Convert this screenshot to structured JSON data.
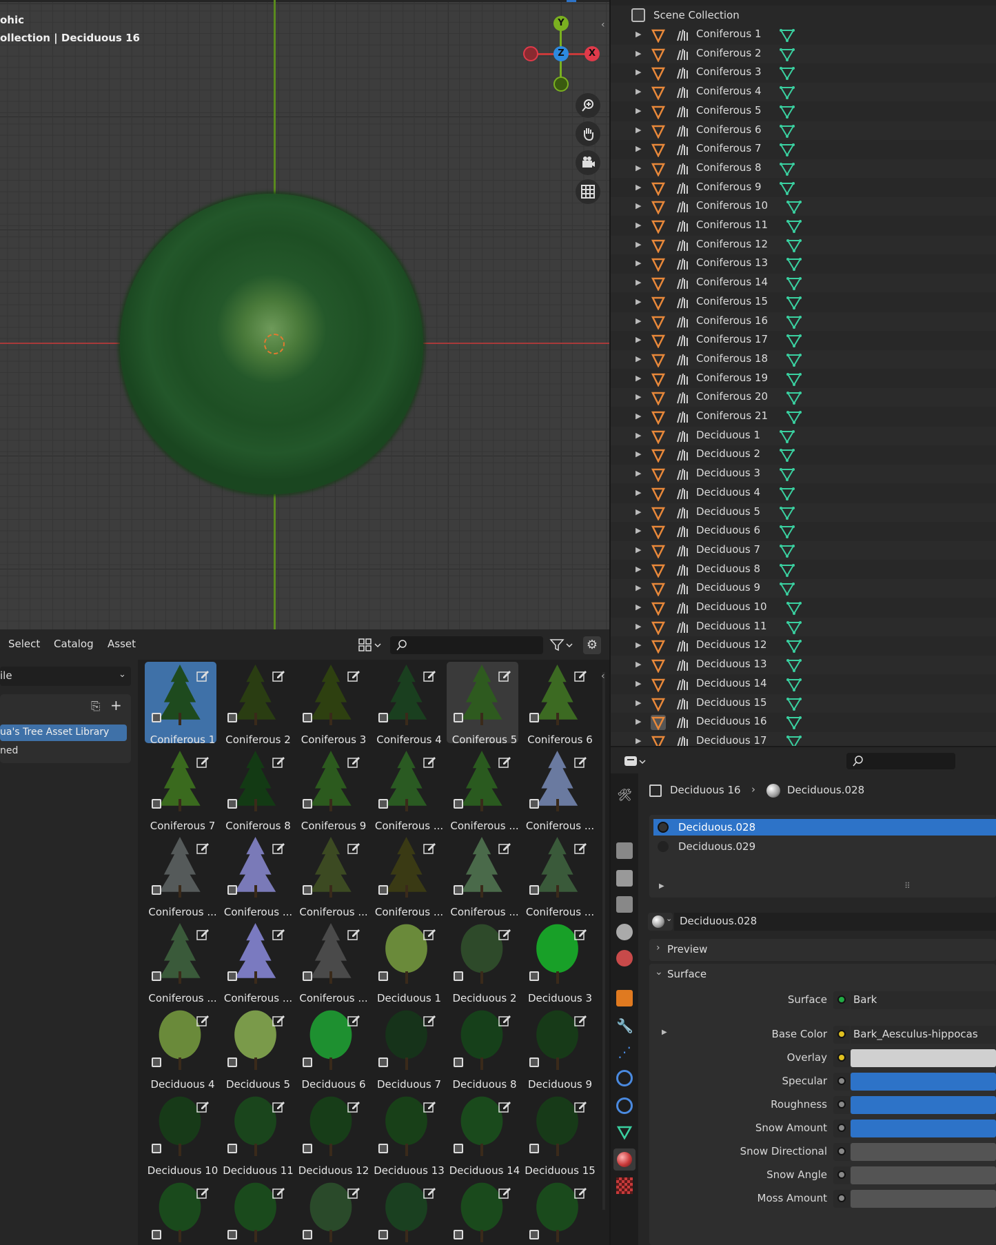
{
  "viewport": {
    "line1": "ohic",
    "line2": "ollection | Deciduous 16",
    "gizmo": {
      "y": "Y",
      "x": "X",
      "z": "Z"
    },
    "nav_icons": [
      "zoom-icon",
      "hand-icon",
      "camera-icon",
      "grid-icon"
    ]
  },
  "asset_browser": {
    "menus": [
      "Select",
      "Catalog",
      "Asset"
    ],
    "search_placeholder": "",
    "dropdown_value": "ile",
    "library_item": "ua's Tree Asset Library",
    "unassigned": "ned",
    "assets": [
      {
        "label": "Coniferous 1",
        "color": "#1e4a1e"
      },
      {
        "label": "Coniferous 2",
        "color": "#2a3d12"
      },
      {
        "label": "Coniferous 3",
        "color": "#2e4010"
      },
      {
        "label": "Coniferous 4",
        "color": "#1a3f1f"
      },
      {
        "label": "Coniferous 5",
        "color": "#2e5a1f"
      },
      {
        "label": "Coniferous 6",
        "color": "#3c6a22"
      },
      {
        "label": "Coniferous 7",
        "color": "#3a6a1e"
      },
      {
        "label": "Coniferous 8",
        "color": "#133a14"
      },
      {
        "label": "Coniferous 9",
        "color": "#2c5a1e"
      },
      {
        "label": "Coniferous ...",
        "color": "#2a5a22"
      },
      {
        "label": "Coniferous ...",
        "color": "#2a5a1f"
      },
      {
        "label": "Coniferous ...",
        "color": "#6a7aa0"
      },
      {
        "label": "Coniferous ...",
        "color": "#555a5a"
      },
      {
        "label": "Coniferous ...",
        "color": "#7a7ab8"
      },
      {
        "label": "Coniferous ...",
        "color": "#3c4a22"
      },
      {
        "label": "Coniferous ...",
        "color": "#3a3a14"
      },
      {
        "label": "Coniferous ...",
        "color": "#4a6a4a"
      },
      {
        "label": "Coniferous ...",
        "color": "#3a5a3a"
      },
      {
        "label": "Coniferous ...",
        "color": "#3a5a3a"
      },
      {
        "label": "Coniferous ...",
        "color": "#7a7ac0"
      },
      {
        "label": "Coniferous ...",
        "color": "#4a4a4a"
      },
      {
        "label": "Deciduous 1",
        "color": "#6a8a3a"
      },
      {
        "label": "Deciduous 2",
        "color": "#2e4a2a"
      },
      {
        "label": "Deciduous 3",
        "color": "#18a028"
      },
      {
        "label": "Deciduous 4",
        "color": "#6a8a3a"
      },
      {
        "label": "Deciduous 5",
        "color": "#7a9a4a"
      },
      {
        "label": "Deciduous 6",
        "color": "#1e9030"
      },
      {
        "label": "Deciduous 7",
        "color": "#16331a"
      },
      {
        "label": "Deciduous 8",
        "color": "#16401a"
      },
      {
        "label": "Deciduous 9",
        "color": "#173a18"
      },
      {
        "label": "Deciduous 10",
        "color": "#173a18"
      },
      {
        "label": "Deciduous 11",
        "color": "#1a451c"
      },
      {
        "label": "Deciduous 12",
        "color": "#173d18"
      },
      {
        "label": "Deciduous 13",
        "color": "#184018"
      },
      {
        "label": "Deciduous 14",
        "color": "#1a4a1c"
      },
      {
        "label": "Deciduous 15",
        "color": "#173a18"
      },
      {
        "label": "",
        "color": "#1a4a1c"
      },
      {
        "label": "",
        "color": "#1a4a1c"
      },
      {
        "label": "",
        "color": "#2a4a2a"
      },
      {
        "label": "",
        "color": "#1a4020"
      },
      {
        "label": "",
        "color": "#1a4a1c"
      },
      {
        "label": "",
        "color": "#1a4a1c"
      }
    ]
  },
  "outliner": {
    "root": "Scene Collection",
    "items": [
      "Coniferous 1",
      "Coniferous 2",
      "Coniferous 3",
      "Coniferous 4",
      "Coniferous 5",
      "Coniferous 6",
      "Coniferous 7",
      "Coniferous 8",
      "Coniferous 9",
      "Coniferous 10",
      "Coniferous 11",
      "Coniferous 12",
      "Coniferous 13",
      "Coniferous 14",
      "Coniferous 15",
      "Coniferous 16",
      "Coniferous 17",
      "Coniferous 18",
      "Coniferous 19",
      "Coniferous 20",
      "Coniferous 21",
      "Deciduous 1",
      "Deciduous 2",
      "Deciduous 3",
      "Deciduous 4",
      "Deciduous 5",
      "Deciduous 6",
      "Deciduous 7",
      "Deciduous 8",
      "Deciduous 9",
      "Deciduous 10",
      "Deciduous 11",
      "Deciduous 12",
      "Deciduous 13",
      "Deciduous 14",
      "Deciduous 15",
      "Deciduous 16",
      "Deciduous 17"
    ]
  },
  "properties": {
    "breadcrumb_object": "Deciduous 16",
    "breadcrumb_material": "Deciduous.028",
    "slots": [
      "Deciduous.028",
      "Deciduous.029"
    ],
    "material_name": "Deciduous.028",
    "panel_preview": "Preview",
    "panel_surface": "Surface",
    "rows": [
      {
        "label": "Surface",
        "value": "Bark",
        "dot": "#22aa44"
      },
      {
        "label": "Base Color",
        "value": "Bark_Aesculus-hippocas",
        "dot": "#e0c020"
      },
      {
        "label": "Overlay",
        "value": "",
        "dot": "#e0c020",
        "bar": "#d0d0d0"
      },
      {
        "label": "Specular",
        "value": "",
        "dot": "#888888",
        "bar": "#2d73c8"
      },
      {
        "label": "Roughness",
        "value": "",
        "dot": "#888888",
        "bar": "#2d73c8"
      },
      {
        "label": "Snow Amount",
        "value": "",
        "dot": "#888888",
        "bar": "#2d73c8"
      },
      {
        "label": "Snow Directional",
        "value": "",
        "dot": "#888888",
        "bar": "#545454"
      },
      {
        "label": "Snow Angle",
        "value": "",
        "dot": "#888888",
        "bar": "#545454"
      },
      {
        "label": "Moss Amount",
        "value": "",
        "dot": "#888888",
        "bar": "#545454"
      }
    ]
  }
}
